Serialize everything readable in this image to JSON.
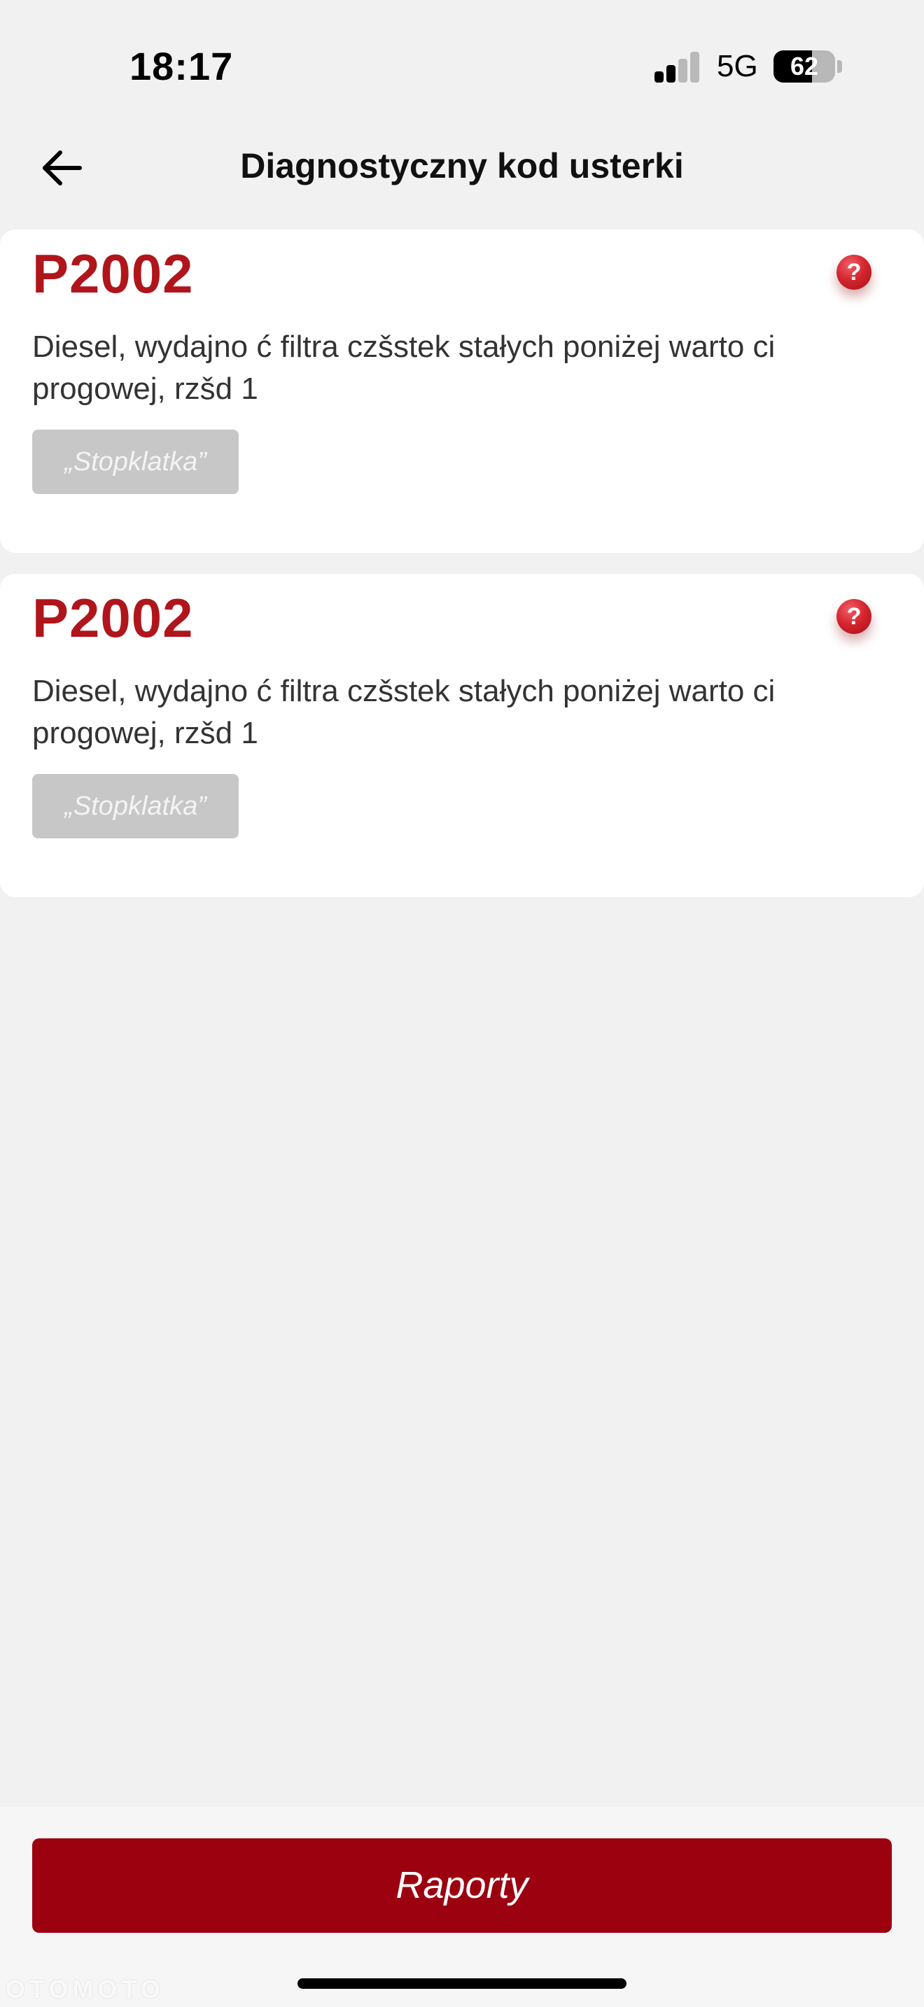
{
  "status_bar": {
    "time": "18:17",
    "network": "5G",
    "battery_level": "62",
    "battery_fraction": 0.62,
    "signal_bars_active": 2,
    "signal_bars_total": 4
  },
  "header": {
    "title": "Diagnostyczny kod usterki",
    "back_icon": "arrow-left-icon"
  },
  "faults": [
    {
      "code": "P2002",
      "description": "Diesel, wydajno ć filtra czšstek stałych poniżej warto ci progowej, rzšd 1",
      "freeze_frame_label": "„Stopklatka”",
      "help_icon": "question-mark-icon",
      "help_symbol": "?"
    },
    {
      "code": "P2002",
      "description": "Diesel, wydajno ć filtra czšstek stałych poniżej warto ci progowej, rzšd 1",
      "freeze_frame_label": "„Stopklatka”",
      "help_icon": "question-mark-icon",
      "help_symbol": "?"
    }
  ],
  "footer": {
    "reports_label": "Raporty"
  },
  "watermark": "OTOMOTO",
  "colors": {
    "fault_code": "#b0151c",
    "primary_button": "#9c0110",
    "disabled_button": "#c7c7c7",
    "background": "#f1f1f1"
  }
}
